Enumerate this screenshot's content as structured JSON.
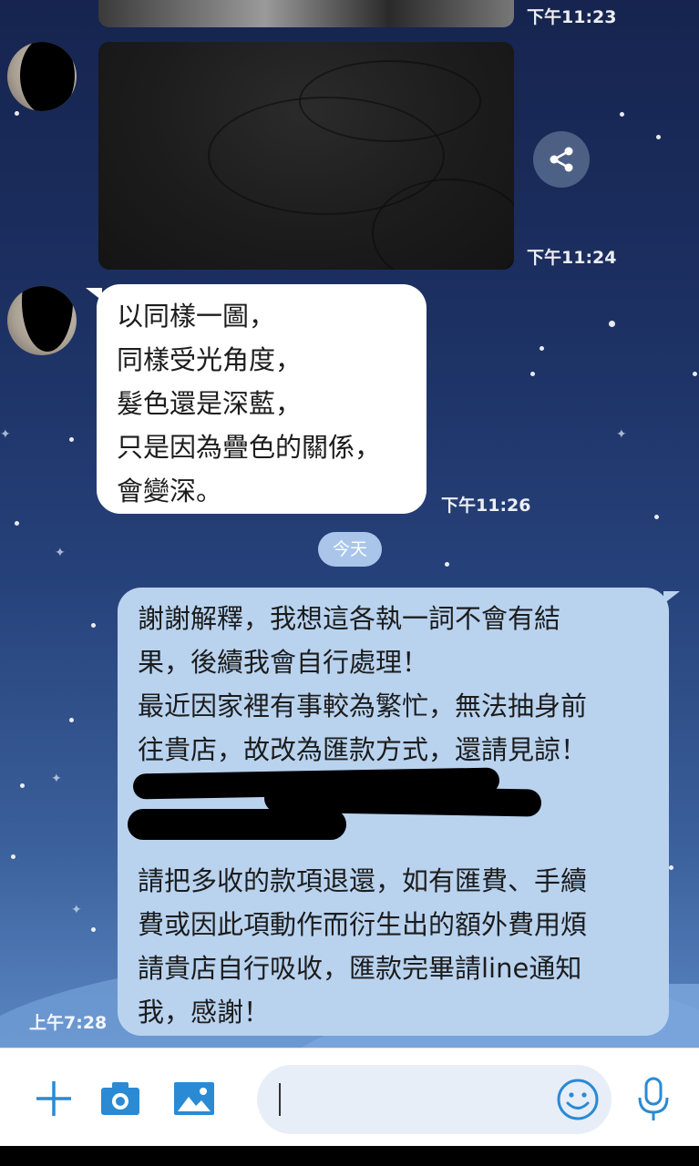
{
  "colors": {
    "accent": "#2a8ad4",
    "incoming_bubble": "#ffffff",
    "outgoing_bubble": "#b9d3ef",
    "date_pill": "#a9c6ea"
  },
  "messages": [
    {
      "type": "image",
      "sender": "other",
      "time": "下午11:23"
    },
    {
      "type": "image",
      "sender": "other",
      "time": "下午11:24"
    },
    {
      "type": "text",
      "sender": "other",
      "time": "下午11:26",
      "lines": [
        "以同樣一圖，",
        "同樣受光角度，",
        "髮色還是深藍，",
        "只是因為疊色的關係，",
        "會變深。"
      ]
    },
    {
      "type": "text",
      "sender": "me",
      "time": "上午7:28",
      "lines": [
        "謝謝解釋，我想這各執一詞不會有結",
        "果，後續我會自行處理！",
        "最近因家裡有事較為繁忙，無法抽身前",
        "往貴店，故改為匯款方式，還請見諒！",
        "",
        "",
        "請把多收的款項退還，如有匯費、手續",
        "費或因此項動作而衍生出的額外費用煩",
        "請貴店自行吸收，匯款完畢請line通知",
        "我，感謝！"
      ]
    }
  ],
  "date_divider": "今天",
  "input_bar": {
    "message_value": "",
    "icons": [
      "plus-icon",
      "camera-icon",
      "image-icon",
      "emoji-icon",
      "microphone-icon"
    ]
  }
}
